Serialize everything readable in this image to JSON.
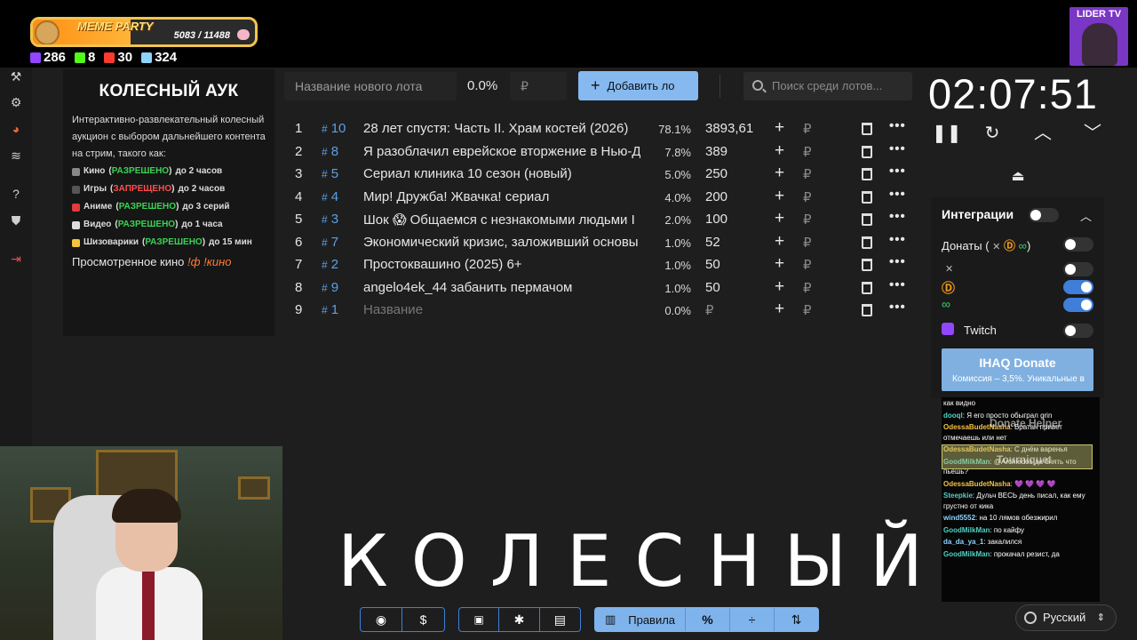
{
  "stream": {
    "meme_title": "MEME PARTY",
    "meme_progress": "5083 / 11488",
    "meme_fraction": 0.44,
    "stats": [
      {
        "icon": "twitch-icon",
        "color": "#9146ff",
        "value": "286"
      },
      {
        "icon": "kick-icon",
        "color": "#53fc18",
        "value": "8"
      },
      {
        "icon": "vk-live-icon",
        "color": "#ff3b30",
        "value": "30"
      },
      {
        "icon": "viewers-icon",
        "color": "#8fd3ff",
        "value": "324"
      }
    ],
    "channel_label": "LIDER TV"
  },
  "sidebar": {
    "items": [
      {
        "name": "auction-icon",
        "glyph": "⚒"
      },
      {
        "name": "settings-icon",
        "glyph": "⚙"
      },
      {
        "name": "wheel-icon",
        "glyph": "◕"
      },
      {
        "name": "layers-icon",
        "glyph": "≋"
      },
      {
        "name": "help-icon",
        "glyph": "?"
      },
      {
        "name": "shield-icon",
        "glyph": "⛊"
      },
      {
        "name": "logout-icon",
        "glyph": "⇥"
      }
    ]
  },
  "info": {
    "title": "КОЛЕСНЫЙ АУК",
    "description": "Интерактивно-развлекательный колесный аукцион с выбором дальнейшего контента на стрим, такого как:",
    "rules": [
      {
        "icon": "film-icon",
        "color": "#888888",
        "category": "Кино",
        "status": "РАЗРЕШЕНО",
        "allowed": true,
        "limit": "до 2 часов"
      },
      {
        "icon": "gamepad-icon",
        "color": "#555555",
        "category": "Игры",
        "status": "ЗАПРЕЩЕНО",
        "allowed": false,
        "limit": "до 2 часов"
      },
      {
        "icon": "anime-icon",
        "color": "#e23b3b",
        "category": "Аниме",
        "status": "РАЗРЕШЕНО",
        "allowed": true,
        "limit": "до 3 серий"
      },
      {
        "icon": "video-icon",
        "color": "#dddddd",
        "category": "Видео",
        "status": "РАЗРЕШЕНО",
        "allowed": true,
        "limit": "до 1 часа"
      },
      {
        "icon": "smile-icon",
        "color": "#f3c33a",
        "category": "Шизоварики",
        "status": "РАЗРЕШЕНО",
        "allowed": true,
        "limit": "до 15 мин"
      }
    ],
    "watched_label": "Просмотренное кино",
    "watched_cmd": "!ф !кино"
  },
  "toolbar": {
    "new_lot_placeholder": "Название нового лота",
    "new_lot_pct": "0.0%",
    "currency": "₽",
    "add_label": "Добавить ло",
    "search_placeholder": "Поиск среди лотов..."
  },
  "lots": [
    {
      "num": "1",
      "id": "10",
      "name": "28 лет спустя: Часть II. Храм костей (2026)",
      "pct": "78.1%",
      "amount": "3893,61"
    },
    {
      "num": "2",
      "id": "8",
      "name": "Я разоблачил еврейское вторжение в Нью-Д",
      "pct": "7.8%",
      "amount": "389"
    },
    {
      "num": "3",
      "id": "5",
      "name": "Сериал клиника 10 сезон (новый)",
      "pct": "5.0%",
      "amount": "250"
    },
    {
      "num": "4",
      "id": "4",
      "name": "Мир! Дружба! Жвачка! сериал",
      "pct": "4.0%",
      "amount": "200"
    },
    {
      "num": "5",
      "id": "3",
      "name": "Шок 😱 Общаемся с незнакомыми людьми I",
      "pct": "2.0%",
      "amount": "100"
    },
    {
      "num": "6",
      "id": "7",
      "name": "Экономический кризис, заложивший основы",
      "pct": "1.0%",
      "amount": "52"
    },
    {
      "num": "7",
      "id": "2",
      "name": "Простоквашино (2025) 6+",
      "pct": "1.0%",
      "amount": "50"
    },
    {
      "num": "8",
      "id": "9",
      "name": "angelo4ek_44 забанить пермачом",
      "pct": "1.0%",
      "amount": "50"
    },
    {
      "num": "9",
      "id": "1",
      "name": "Название",
      "pct": "0.0%",
      "amount": "₽",
      "placeholder": true
    }
  ],
  "timer": {
    "value": "02:07:51"
  },
  "integrations": {
    "title": "Интеграции",
    "donations_label": "Донаты (",
    "donations_suffix": ")",
    "twitch_label": "Twitch",
    "ihaq_title": "IHAQ Donate",
    "ihaq_subtitle": "Комиссия – 3,5%. Уникальные в",
    "toggles": {
      "master": false,
      "donations": false,
      "x": false,
      "donationalerts": true,
      "link": true,
      "twitch": false
    }
  },
  "chat": {
    "ghost_1": "Donate Helper",
    "ghost_2": "Tourniquet",
    "messages": [
      {
        "user": "",
        "color": "#ffffff",
        "text": "как видно"
      },
      {
        "user": "dooql",
        "color": "#4fd1c5",
        "text": "Я его просто обыграл grin"
      },
      {
        "user": "OdessaBudetNasha",
        "color": "#f5c242",
        "text": "Братан привет отмечаешь или нет"
      },
      {
        "user": "OdessaBudetNasha",
        "color": "#f5c242",
        "text": "С днём варенья"
      },
      {
        "user": "GoodMilkMan",
        "color": "#4fd1c5",
        "text": "@Archiedos да блять что пьешь?"
      },
      {
        "user": "OdessaBudetNasha",
        "color": "#f5c242",
        "text": "💜 💜 💜 💜"
      },
      {
        "user": "Steepkie",
        "color": "#4fd1c5",
        "text": "Дульч ВЕСЬ день писал, как ему грустно от кика"
      },
      {
        "user": "wind5552",
        "color": "#8fd3ff",
        "text": "на 10 лямов обезжирил"
      },
      {
        "user": "GoodMilkMan",
        "color": "#4fd1c5",
        "text": "по кайфу"
      },
      {
        "user": "da_da_ya_1",
        "color": "#8fd3ff",
        "text": "закалился"
      },
      {
        "user": "GoodMilkMan",
        "color": "#4fd1c5",
        "text": "прокачал резист, да"
      }
    ]
  },
  "overlay_title": "КОЛЕСНЫЙ",
  "bottom": {
    "rules_label": "Правила"
  },
  "language": {
    "selected": "Русский"
  }
}
